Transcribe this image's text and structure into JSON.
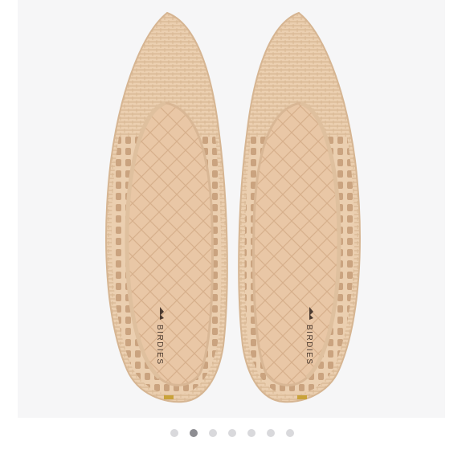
{
  "product_image": {
    "icon": "product-photo",
    "brand_mark": "BIRDIES",
    "colors": {
      "background": "#f6f6f7",
      "upper": "#ebcfb0",
      "upper_shadow": "#d8b894",
      "insole": "#e9c7a6",
      "quilt_line": "#d7b08c",
      "logo": "#4a3a30"
    }
  },
  "carousel": {
    "total": 7,
    "active_index": 2,
    "colors": {
      "inactive": "#d9d9dc",
      "active": "#8d8d92"
    }
  }
}
